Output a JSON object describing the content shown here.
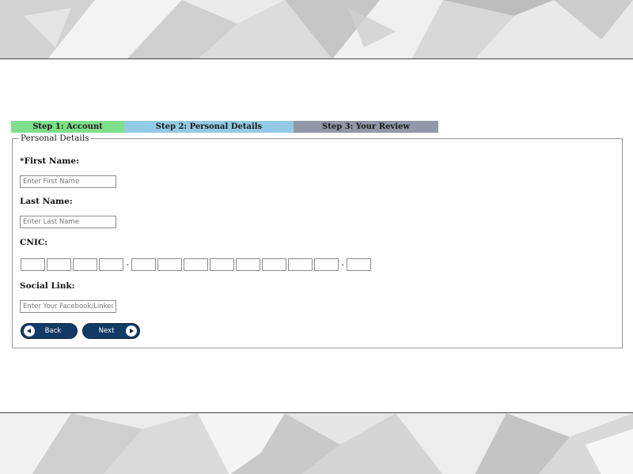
{
  "colors": {
    "step_1_bg": "#7ee08a",
    "step_2_bg": "#92cbe3",
    "step_3_bg": "#9298a8",
    "button_bg": "#123a66"
  },
  "steps": [
    {
      "label": "Step 1: Account"
    },
    {
      "label": "Step 2: Personal Details"
    },
    {
      "label": "Step 3: Your Review"
    }
  ],
  "form": {
    "legend": "Personal Details",
    "first_name": {
      "label": "*First Name:",
      "placeholder": "Enter First Name",
      "value": ""
    },
    "last_name": {
      "label": "Last Name:",
      "placeholder": "Enter Last Name",
      "value": ""
    },
    "cnic": {
      "label": "CNIC:",
      "separator": "-"
    },
    "social_link": {
      "label": "Social Link:",
      "placeholder": "Enter Your Facebook/Linkedin",
      "value": ""
    }
  },
  "buttons": {
    "back": {
      "label": "Back",
      "icon": "arrow-left-icon"
    },
    "next": {
      "label": "Next",
      "icon": "arrow-right-icon"
    }
  }
}
